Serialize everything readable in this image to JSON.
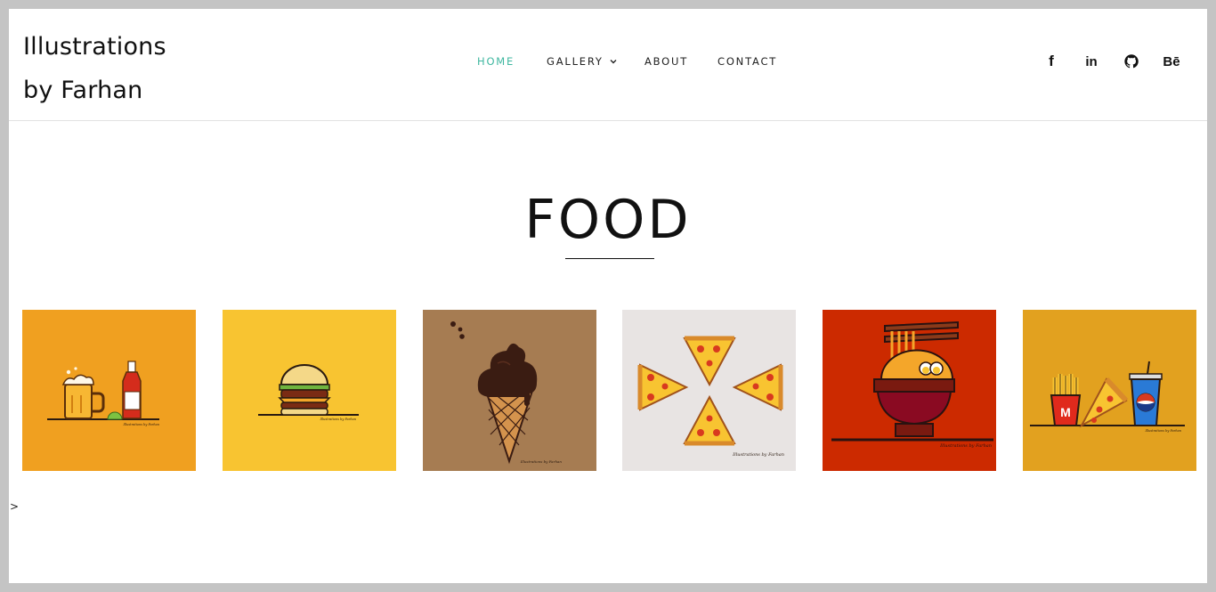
{
  "site": {
    "logo_line1": "Illustrations",
    "logo_line2": "by Farhan"
  },
  "nav": {
    "home": "HOME",
    "gallery": "GALLERY",
    "about": "ABOUT",
    "contact": "CONTACT",
    "active": "HOME",
    "active_color": "#3fb7a0"
  },
  "social": {
    "facebook": "f",
    "linkedin": "in",
    "github": "github-icon",
    "behance": "Bē"
  },
  "page": {
    "title": "FOOD",
    "stray_text": ">"
  },
  "gallery": [
    {
      "name": "beer-and-sauce-illustration",
      "bg": "#f0a020",
      "watermark": "Illustrations by Farhan"
    },
    {
      "name": "burger-illustration",
      "bg": "#f8c431",
      "watermark": "Illustrations by Farhan"
    },
    {
      "name": "ice-cream-cone-illustration",
      "bg": "#a67c52",
      "watermark": "Illustrations by Farhan"
    },
    {
      "name": "pizza-slices-illustration",
      "bg": "#e8e4e3",
      "watermark": "Illustrations by Farhan"
    },
    {
      "name": "ramen-bowl-illustration",
      "bg": "#cc2a00",
      "watermark": "Illustrations by Farhan"
    },
    {
      "name": "fries-pizza-soda-illustration",
      "bg": "#e2a11f",
      "watermark": "Illustrations by Farhan"
    }
  ]
}
